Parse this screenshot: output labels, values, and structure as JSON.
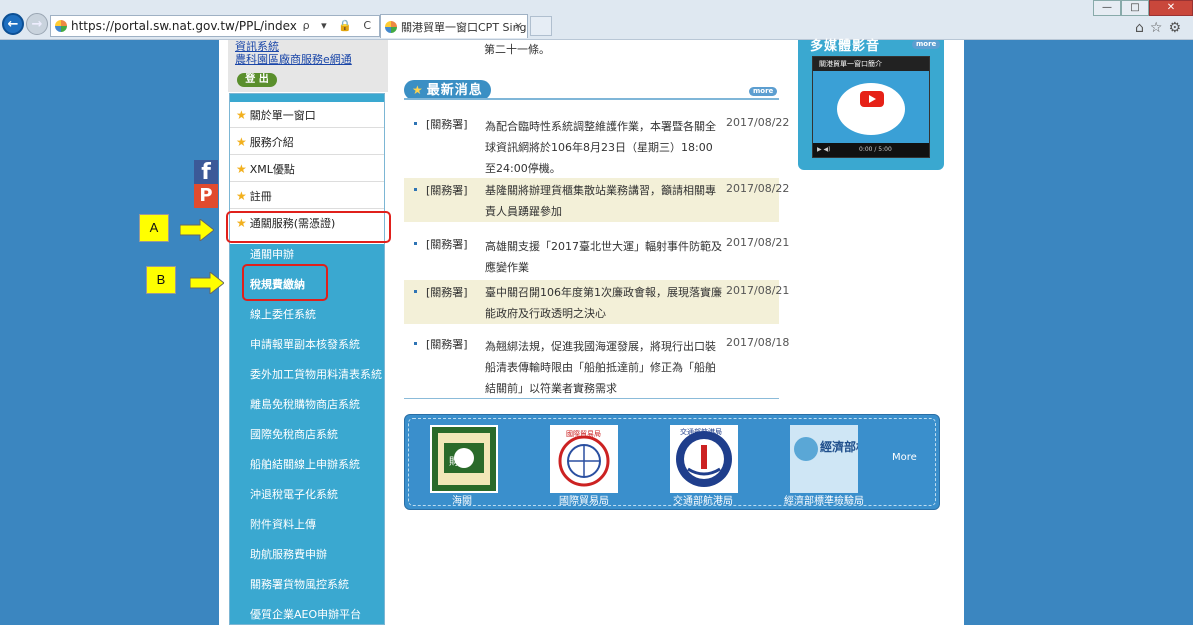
{
  "browser": {
    "url": "https://portal.sw.nat.gov.tw/PPL/index",
    "tab_title": "關港貿單一窗口CPT Single...",
    "tab_close": "×",
    "addr_ctrls": "ρ ▾ 🔒 C"
  },
  "header": {
    "links": [
      "資訊系統",
      "農科園區廠商服務e網通"
    ],
    "logout": "登 出"
  },
  "sidebar": {
    "items": [
      {
        "label": "關於單一窗口"
      },
      {
        "label": "服務介紹"
      },
      {
        "label": "XML優點"
      },
      {
        "label": "註冊"
      },
      {
        "label": "通關服務(需憑證)"
      }
    ],
    "sub_items": [
      "通關申辦",
      "稅規費繳納",
      "線上委任系統",
      "申請報單副本核發系統",
      "委外加工貨物用料清表系統",
      "離島免稅購物商店系統",
      "國際免稅商店系統",
      "船舶結關線上申辦系統",
      "沖退稅電子化系統",
      "附件資料上傳",
      "助航服務費申辦",
      "關務署貨物風控系統",
      "優質企業AEO申辦平台"
    ]
  },
  "social": {
    "facebook": "f",
    "plurk": "P"
  },
  "annotations": {
    "a": "A",
    "b": "B"
  },
  "news": {
    "snippet_line": "第二十一條。",
    "title": "最新消息",
    "more": "more",
    "items": [
      {
        "cat": "[關務署]",
        "text": "為配合臨時性系統調整維護作業，本署暨各關全球資訊網將於106年8月23日（星期三）18:00至24:00停機。",
        "date": "2017/08/22"
      },
      {
        "cat": "[關務署]",
        "text": "基隆關將辦理貨櫃集散站業務講習，籲請相關專責人員踴躍參加",
        "date": "2017/08/22"
      },
      {
        "cat": "[關務署]",
        "text": "高雄關支援「2017臺北世大運」輻射事件防範及應變作業",
        "date": "2017/08/21"
      },
      {
        "cat": "[關務署]",
        "text": "臺中關召開106年度第1次廉政會報，展現落實廉能政府及行政透明之決心",
        "date": "2017/08/21"
      },
      {
        "cat": "[關務署]",
        "text": "為翹綁法規，促進我國海運發展，將現行出口裝船清表傳輸時限由「船舶抵達前」修正為「船舶結關前」以符業者實務需求",
        "date": "2017/08/18"
      }
    ]
  },
  "media": {
    "title": "多媒體影音",
    "more": "more",
    "video_title": "關港貿單一窗口簡介",
    "video_time": "0:00 / 5:00"
  },
  "logos": {
    "items": [
      {
        "label": "海關",
        "text": "財"
      },
      {
        "label": "國際貿易局",
        "text": "國際貿易局"
      },
      {
        "label": "交通部航港局",
        "text": "交通部航港局"
      },
      {
        "label": "經濟部標準檢驗局",
        "text": "經濟部標準檢驗局"
      }
    ],
    "more": "More"
  },
  "colors": {
    "accent": "#3a8fc4",
    "sidebar": "#3aa8d0",
    "highlight_box": "#e0201b",
    "annotation": "#ffff00"
  }
}
